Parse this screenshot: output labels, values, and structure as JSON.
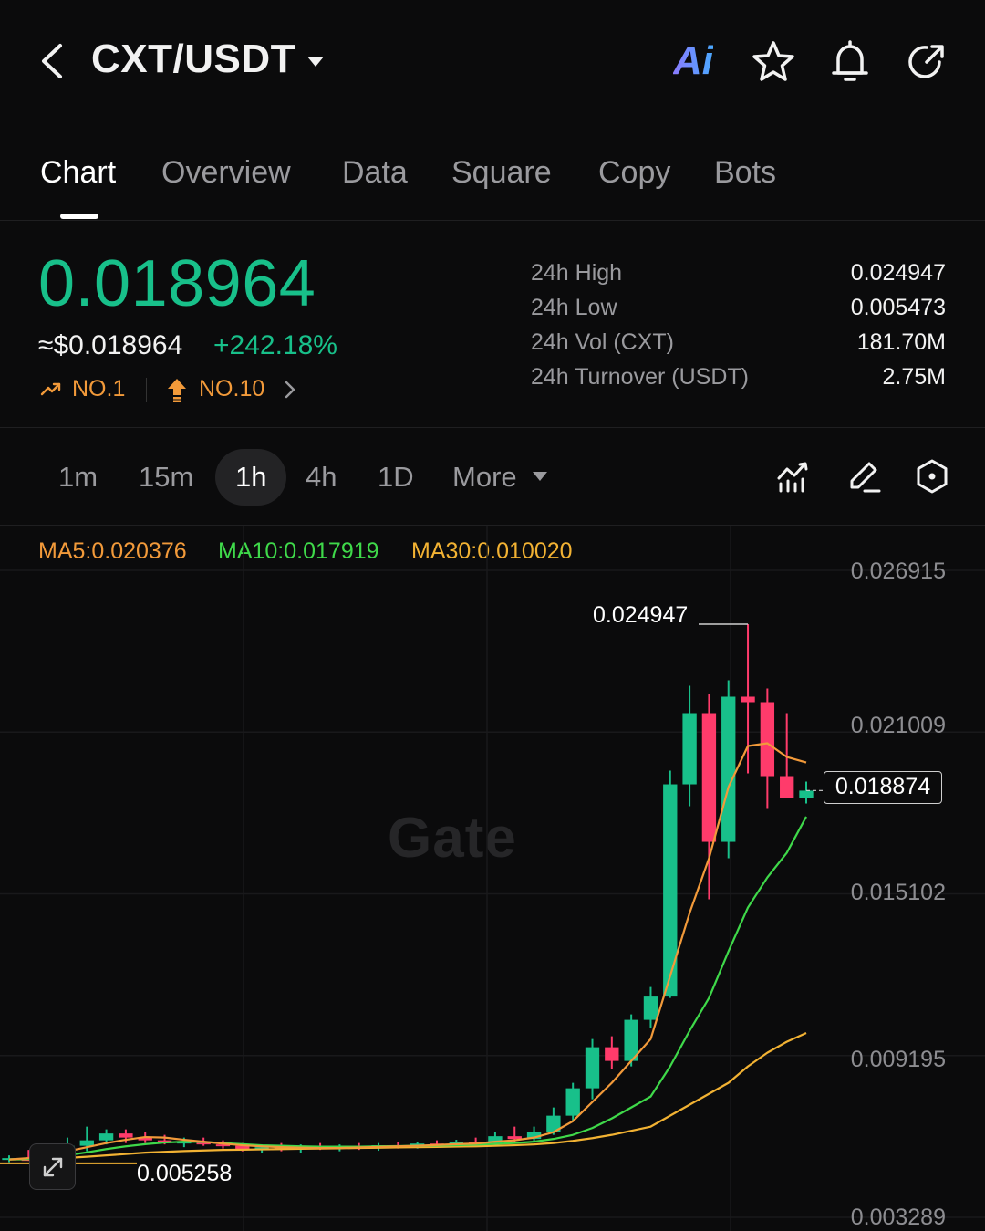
{
  "header": {
    "pair": "CXT/USDT",
    "ai_label": "Ai",
    "icons": [
      "back-arrow-icon",
      "caret-down-icon",
      "ai-assistant-icon",
      "star-icon",
      "bell-icon",
      "share-icon"
    ]
  },
  "tabs": [
    {
      "label": "Chart",
      "active": true
    },
    {
      "label": "Overview",
      "active": false
    },
    {
      "label": "Data",
      "active": false
    },
    {
      "label": "Square",
      "active": false
    },
    {
      "label": "Copy",
      "active": false
    },
    {
      "label": "Bots",
      "active": false
    }
  ],
  "ticker": {
    "last_price": "0.018964",
    "usd_price": "≈$0.018964",
    "change_pct": "+242.18%",
    "rank_gainers": "NO.1",
    "rank_hot": "NO.10"
  },
  "stats": [
    {
      "label": "24h  High",
      "value": "0.024947"
    },
    {
      "label": "24h  Low",
      "value": "0.005473"
    },
    {
      "label": "24h  Vol (CXT)",
      "value": "181.70M"
    },
    {
      "label": "24h  Turnover (USDT)",
      "value": "2.75M"
    }
  ],
  "intervals": [
    {
      "label": "1m",
      "active": false
    },
    {
      "label": "15m",
      "active": false
    },
    {
      "label": "1h",
      "active": true
    },
    {
      "label": "4h",
      "active": false
    },
    {
      "label": "1D",
      "active": false
    },
    {
      "label": "More",
      "active": false
    }
  ],
  "ma": {
    "ma5": "MA5:0.020376",
    "ma10": "MA10:0.017919",
    "ma30": "MA30:0.010020"
  },
  "colors": {
    "up": "#18c08a",
    "down": "#ff3b6b",
    "ma5": "#f29a3a",
    "ma10": "#3fd94a",
    "ma30": "#f2b233",
    "accent": "#18c08a"
  },
  "chart_data": {
    "type": "candlestick",
    "y_ticks": [
      "0.026915",
      "0.021009",
      "0.015102",
      "0.009195",
      "0.003289"
    ],
    "ylim": [
      0.003289,
      0.026915
    ],
    "high_marker": "0.024947",
    "low_marker": "0.005258",
    "last_price_marker": "0.018874",
    "watermark": "Gate",
    "candles": [
      {
        "o": 0.0054,
        "h": 0.00555,
        "l": 0.0053,
        "c": 0.00545
      },
      {
        "o": 0.00545,
        "h": 0.00575,
        "l": 0.00535,
        "c": 0.00535
      },
      {
        "o": 0.00535,
        "h": 0.0057,
        "l": 0.00526,
        "c": 0.0056
      },
      {
        "o": 0.0056,
        "h": 0.0062,
        "l": 0.0055,
        "c": 0.0059
      },
      {
        "o": 0.0059,
        "h": 0.0066,
        "l": 0.0057,
        "c": 0.0061
      },
      {
        "o": 0.0061,
        "h": 0.0065,
        "l": 0.00595,
        "c": 0.00635
      },
      {
        "o": 0.00635,
        "h": 0.0065,
        "l": 0.006,
        "c": 0.0062
      },
      {
        "o": 0.0062,
        "h": 0.0064,
        "l": 0.006,
        "c": 0.0061
      },
      {
        "o": 0.0061,
        "h": 0.0063,
        "l": 0.00595,
        "c": 0.006
      },
      {
        "o": 0.006,
        "h": 0.0062,
        "l": 0.00585,
        "c": 0.00605
      },
      {
        "o": 0.00605,
        "h": 0.0062,
        "l": 0.0059,
        "c": 0.00595
      },
      {
        "o": 0.00595,
        "h": 0.0061,
        "l": 0.0058,
        "c": 0.0059
      },
      {
        "o": 0.0059,
        "h": 0.006,
        "l": 0.0057,
        "c": 0.00575
      },
      {
        "o": 0.00575,
        "h": 0.00595,
        "l": 0.00565,
        "c": 0.00585
      },
      {
        "o": 0.00585,
        "h": 0.006,
        "l": 0.0057,
        "c": 0.0058
      },
      {
        "o": 0.0058,
        "h": 0.00595,
        "l": 0.00565,
        "c": 0.0059
      },
      {
        "o": 0.0059,
        "h": 0.006,
        "l": 0.00575,
        "c": 0.0058
      },
      {
        "o": 0.0058,
        "h": 0.00595,
        "l": 0.0057,
        "c": 0.00588
      },
      {
        "o": 0.00588,
        "h": 0.006,
        "l": 0.00575,
        "c": 0.00582
      },
      {
        "o": 0.00582,
        "h": 0.006,
        "l": 0.00572,
        "c": 0.00592
      },
      {
        "o": 0.00592,
        "h": 0.00605,
        "l": 0.0058,
        "c": 0.0059
      },
      {
        "o": 0.0059,
        "h": 0.00605,
        "l": 0.0058,
        "c": 0.00598
      },
      {
        "o": 0.00598,
        "h": 0.0061,
        "l": 0.00585,
        "c": 0.00595
      },
      {
        "o": 0.00595,
        "h": 0.00612,
        "l": 0.00588,
        "c": 0.00605
      },
      {
        "o": 0.00605,
        "h": 0.0062,
        "l": 0.00592,
        "c": 0.006
      },
      {
        "o": 0.006,
        "h": 0.0064,
        "l": 0.00595,
        "c": 0.00625
      },
      {
        "o": 0.00625,
        "h": 0.0066,
        "l": 0.00605,
        "c": 0.00615
      },
      {
        "o": 0.00615,
        "h": 0.0066,
        "l": 0.00605,
        "c": 0.0064
      },
      {
        "o": 0.0064,
        "h": 0.0073,
        "l": 0.0063,
        "c": 0.007
      },
      {
        "o": 0.007,
        "h": 0.0082,
        "l": 0.0068,
        "c": 0.008
      },
      {
        "o": 0.008,
        "h": 0.0098,
        "l": 0.0076,
        "c": 0.0095
      },
      {
        "o": 0.0095,
        "h": 0.0099,
        "l": 0.0087,
        "c": 0.009
      },
      {
        "o": 0.009,
        "h": 0.0107,
        "l": 0.0088,
        "c": 0.0105
      },
      {
        "o": 0.0105,
        "h": 0.0117,
        "l": 0.0102,
        "c": 0.01135
      },
      {
        "o": 0.01135,
        "h": 0.0196,
        "l": 0.0113,
        "c": 0.0191
      },
      {
        "o": 0.0191,
        "h": 0.0227,
        "l": 0.0183,
        "c": 0.0217
      },
      {
        "o": 0.0217,
        "h": 0.0224,
        "l": 0.0149,
        "c": 0.017
      },
      {
        "o": 0.017,
        "h": 0.0229,
        "l": 0.0164,
        "c": 0.0223
      },
      {
        "o": 0.0223,
        "h": 0.02495,
        "l": 0.0195,
        "c": 0.0221
      },
      {
        "o": 0.0221,
        "h": 0.0226,
        "l": 0.0182,
        "c": 0.0194
      },
      {
        "o": 0.0194,
        "h": 0.0217,
        "l": 0.0186,
        "c": 0.0186
      },
      {
        "o": 0.0186,
        "h": 0.0192,
        "l": 0.0184,
        "c": 0.01887
      }
    ],
    "ma5": [
      0.0054,
      0.00545,
      0.00555,
      0.0057,
      0.00585,
      0.006,
      0.00612,
      0.00622,
      0.0062,
      0.00612,
      0.00605,
      0.00598,
      0.00592,
      0.00588,
      0.00585,
      0.00583,
      0.00582,
      0.00582,
      0.00584,
      0.00586,
      0.00588,
      0.0059,
      0.00593,
      0.00596,
      0.00598,
      0.00605,
      0.0061,
      0.0062,
      0.0064,
      0.0068,
      0.0075,
      0.0082,
      0.009,
      0.0098,
      0.0121,
      0.0144,
      0.0164,
      0.019,
      0.0205,
      0.0206,
      0.0201,
      0.0199
    ],
    "ma10": [
      0.0054,
      0.00542,
      0.00548,
      0.00556,
      0.00566,
      0.00578,
      0.00588,
      0.00596,
      0.00602,
      0.00605,
      0.00604,
      0.006,
      0.00596,
      0.00592,
      0.0059,
      0.00588,
      0.00587,
      0.00587,
      0.00587,
      0.00588,
      0.00589,
      0.0059,
      0.00591,
      0.00592,
      0.00594,
      0.00597,
      0.006,
      0.00605,
      0.00615,
      0.0063,
      0.00655,
      0.0069,
      0.0073,
      0.0077,
      0.0088,
      0.0101,
      0.0113,
      0.013,
      0.0146,
      0.0157,
      0.0166,
      0.01792
    ],
    "ma30": [
      0.0054,
      0.00541,
      0.00543,
      0.00546,
      0.0055,
      0.00555,
      0.0056,
      0.00565,
      0.00568,
      0.00571,
      0.00573,
      0.00575,
      0.00576,
      0.00577,
      0.00578,
      0.00579,
      0.0058,
      0.00581,
      0.00582,
      0.00583,
      0.00584,
      0.00585,
      0.00586,
      0.00587,
      0.00588,
      0.0059,
      0.00592,
      0.00595,
      0.006,
      0.00608,
      0.00618,
      0.0063,
      0.00645,
      0.0066,
      0.007,
      0.0074,
      0.0078,
      0.0082,
      0.0088,
      0.0093,
      0.0097,
      0.01002
    ]
  }
}
